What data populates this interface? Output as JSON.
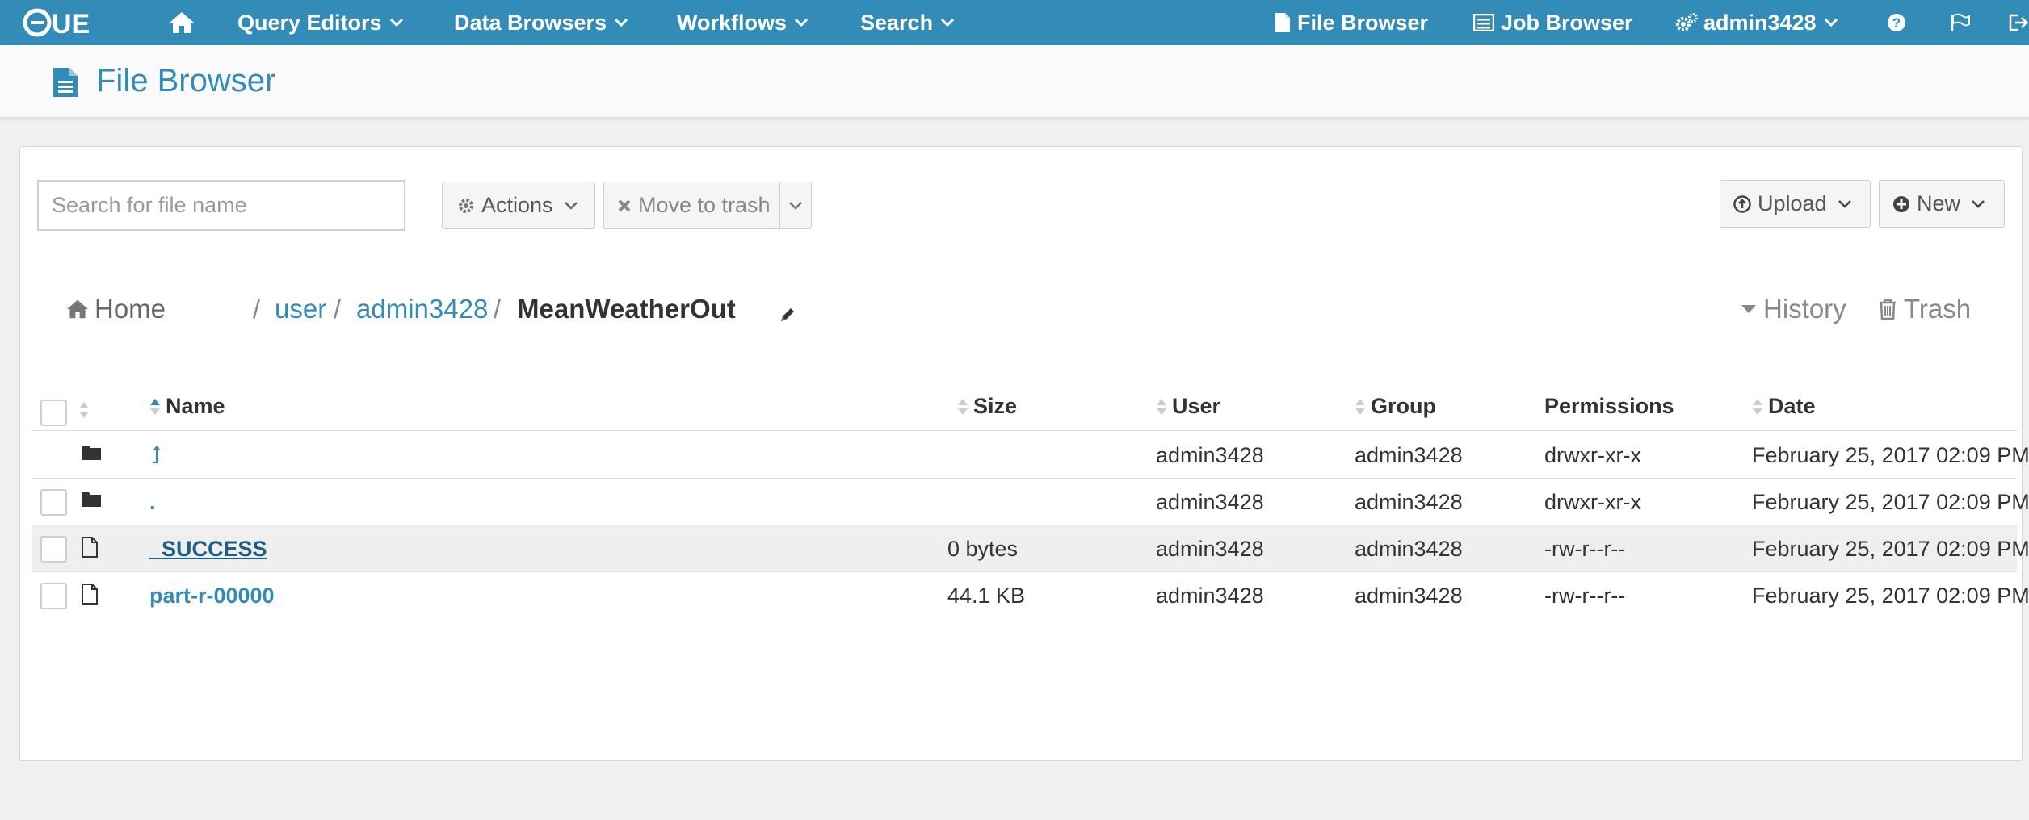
{
  "nav": {
    "logo": "HUE",
    "query_editors": "Query Editors",
    "data_browsers": "Data Browsers",
    "workflows": "Workflows",
    "search": "Search",
    "file_browser": "File Browser",
    "job_browser": "Job Browser",
    "user": "admin3428"
  },
  "page": {
    "title": "File Browser"
  },
  "toolbar": {
    "search_placeholder": "Search for file name",
    "actions": "Actions",
    "move_to_trash": "Move to trash",
    "upload": "Upload",
    "new": "New"
  },
  "breadcrumb": {
    "home": "Home",
    "parts": [
      "user",
      "admin3428"
    ],
    "current": "MeanWeatherOut",
    "history": "History",
    "trash": "Trash"
  },
  "table": {
    "columns": [
      "Name",
      "Size",
      "User",
      "Group",
      "Permissions",
      "Date"
    ],
    "rows": [
      {
        "name": "↥",
        "size": "",
        "user": "admin3428",
        "group": "admin3428",
        "perm": "drwxr-xr-x",
        "date": "February 25, 2017 02:09 PM"
      },
      {
        "name": ".",
        "size": "",
        "user": "admin3428",
        "group": "admin3428",
        "perm": "drwxr-xr-x",
        "date": "February 25, 2017 02:09 PM"
      },
      {
        "name": "_SUCCESS",
        "size": "0 bytes",
        "user": "admin3428",
        "group": "admin3428",
        "perm": "-rw-r--r--",
        "date": "February 25, 2017 02:09 PM"
      },
      {
        "name": "part-r-00000",
        "size": "44.1 KB",
        "user": "admin3428",
        "group": "admin3428",
        "perm": "-rw-r--r--",
        "date": "February 25, 2017 02:09 PM"
      }
    ]
  },
  "colors": {
    "brand": "#338bb8",
    "nav_bg": "#338bb8"
  }
}
